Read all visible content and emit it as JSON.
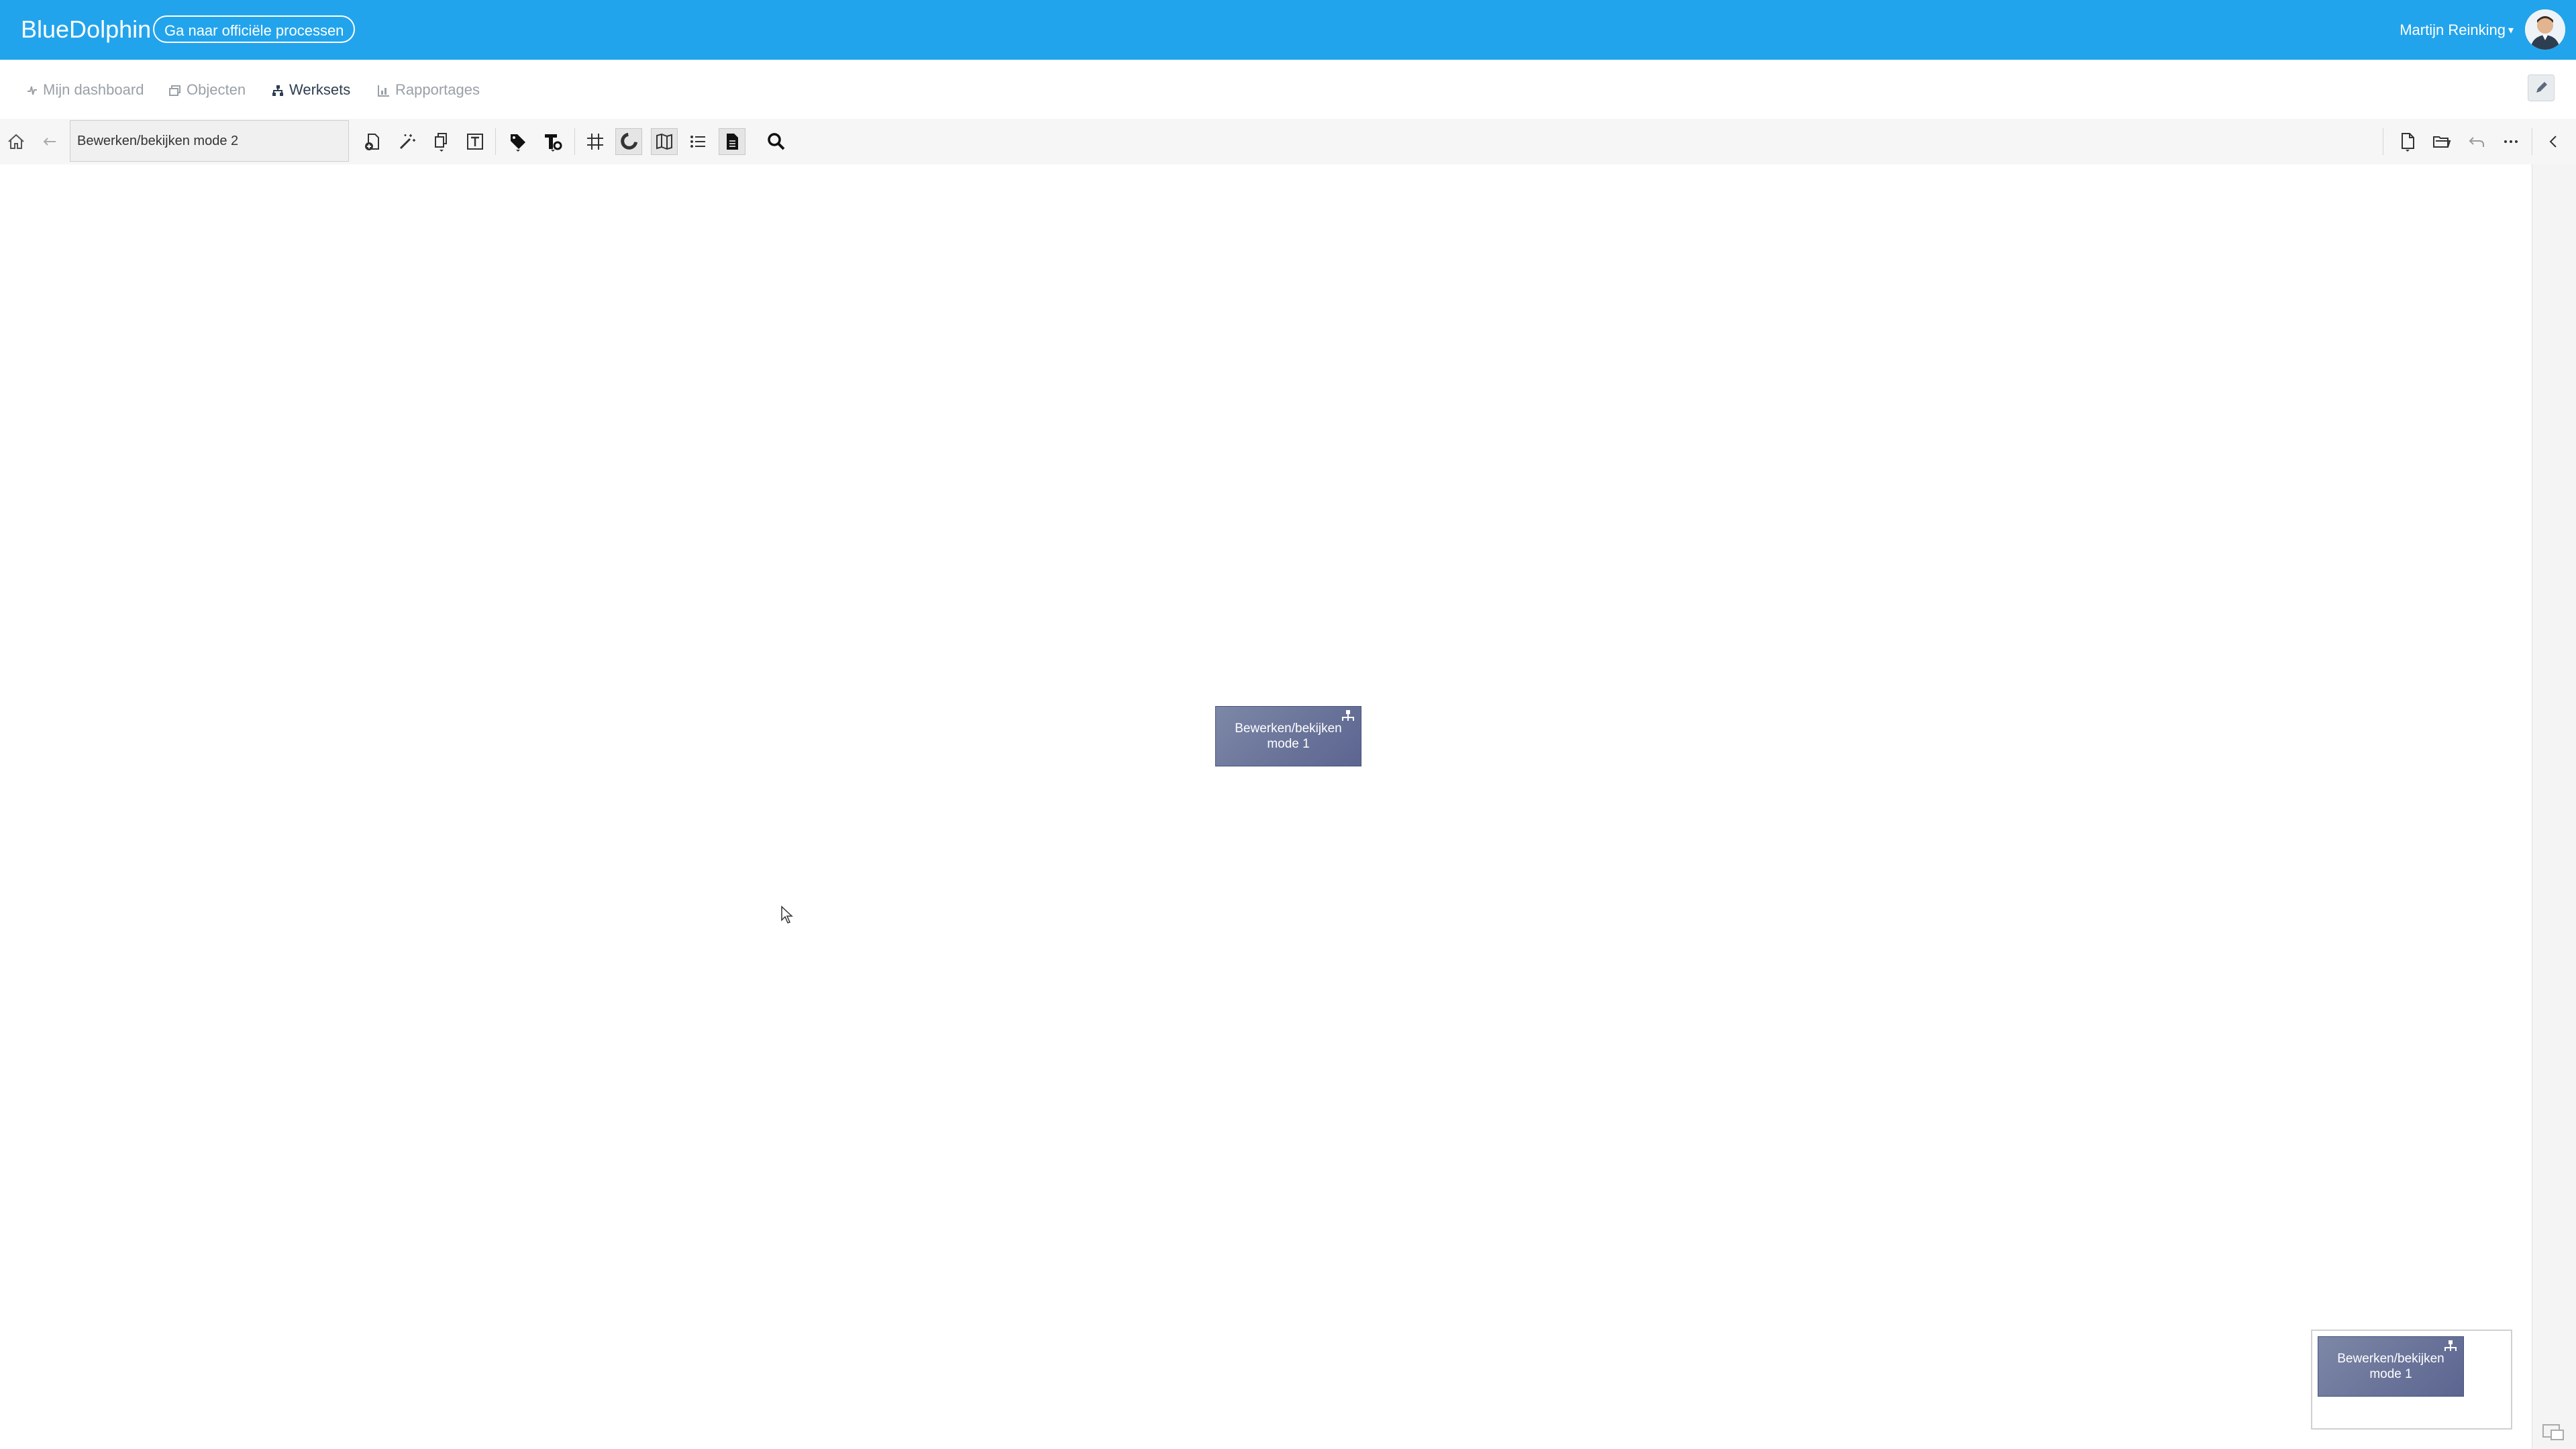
{
  "app": {
    "brand": "BlueDolphin",
    "official_button": "Ga naar officiële processen",
    "user_name": "Martijn Reinking",
    "accent_color": "#22a4ec"
  },
  "nav": {
    "items": [
      {
        "label": "Mijn dashboard",
        "icon": "pulse-icon"
      },
      {
        "label": "Objecten",
        "icon": "objects-icon"
      },
      {
        "label": "Werksets",
        "icon": "workset-icon",
        "active": true
      },
      {
        "label": "Rapportages",
        "icon": "chart-icon"
      }
    ]
  },
  "toolbar": {
    "title_value": "Bewerken/bekijken mode 2",
    "left_icons": [
      "home-icon",
      "back-arrow-icon"
    ],
    "tool_icons": [
      "add-object-icon",
      "magic-wand-icon",
      "copy-icon",
      "text-tool-icon",
      "tag-icon",
      "tag-settings-icon",
      "grid-icon",
      "magnet-icon",
      "map-icon",
      "list-icon",
      "document-icon",
      "search-icon"
    ],
    "right_icons": [
      "new-page-icon",
      "open-folder-icon",
      "undo-icon",
      "more-icon",
      "collapse-left-icon"
    ]
  },
  "canvas": {
    "node_label": "Bewerken/bekijken mode 1",
    "node_color": "#6a7399"
  },
  "minimap": {
    "node_label": "Bewerken/bekijken mode 1"
  }
}
